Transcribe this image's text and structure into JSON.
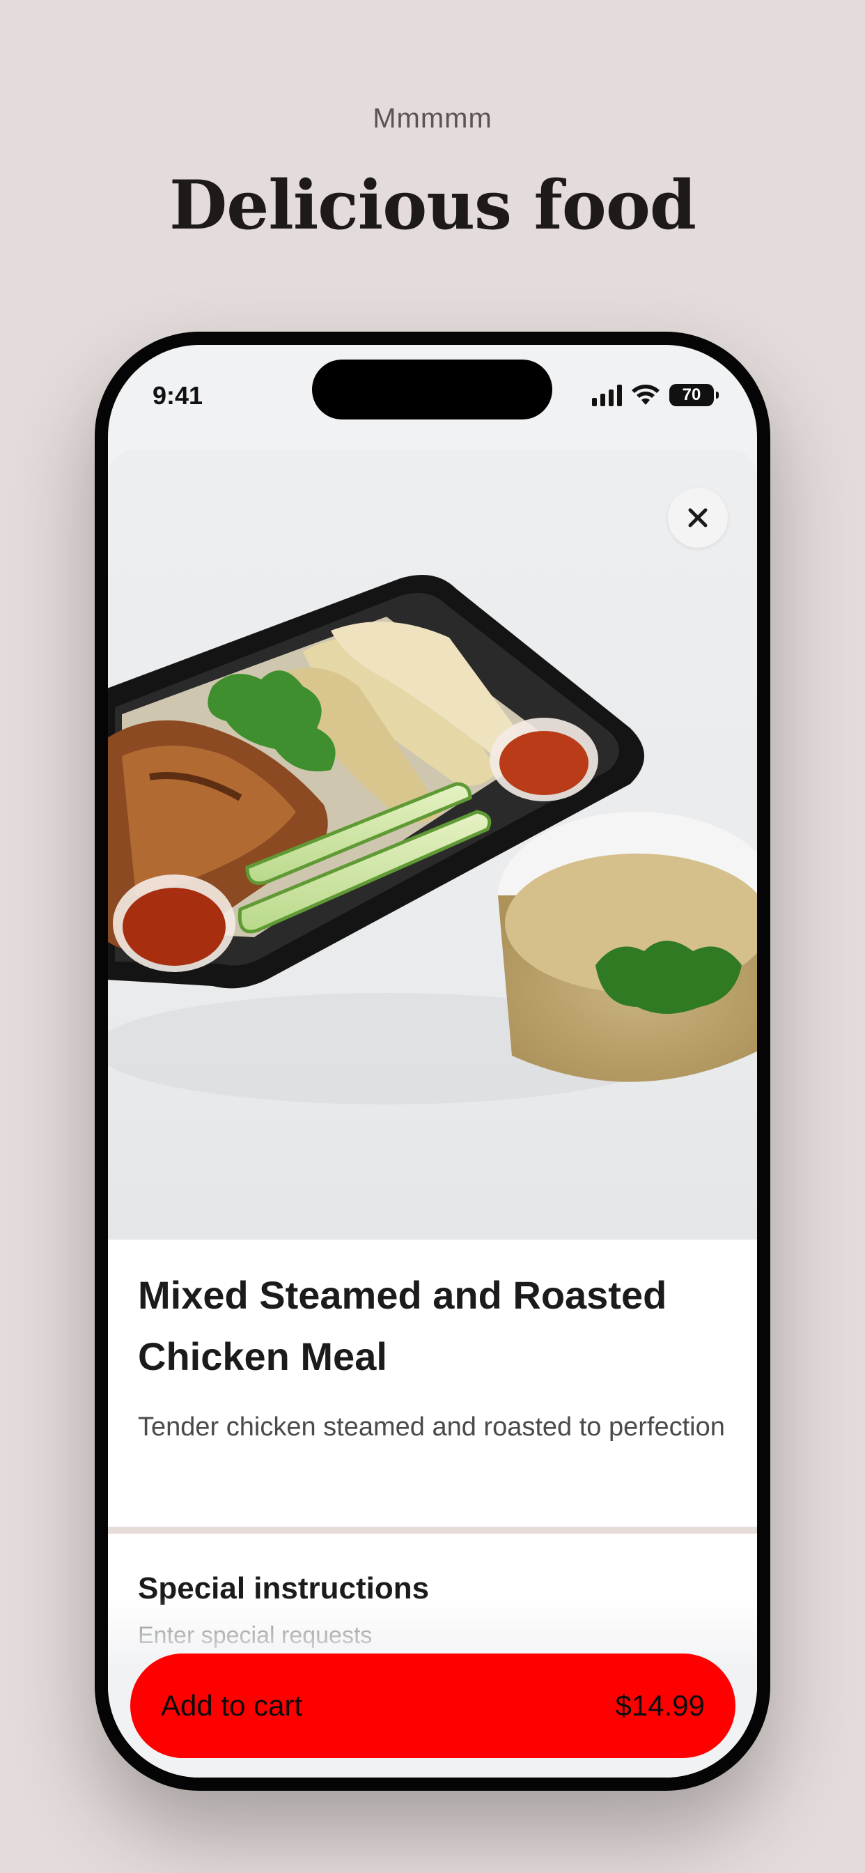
{
  "hero": {
    "subtitle": "Mmmmm",
    "title": "Delicious food"
  },
  "status_bar": {
    "time": "9:41",
    "battery": "70"
  },
  "item": {
    "title": "Mixed Steamed and Roasted Chicken Meal",
    "description": "Tender chicken steamed and roasted to perfection",
    "image_icon": "food-photo"
  },
  "instructions": {
    "heading": "Special instructions",
    "placeholder": "Enter special requests"
  },
  "cart": {
    "label": "Add to cart",
    "price": "$14.99"
  },
  "colors": {
    "background": "#e4dcda",
    "accent": "#ff0000",
    "phone_frame": "#050505"
  }
}
